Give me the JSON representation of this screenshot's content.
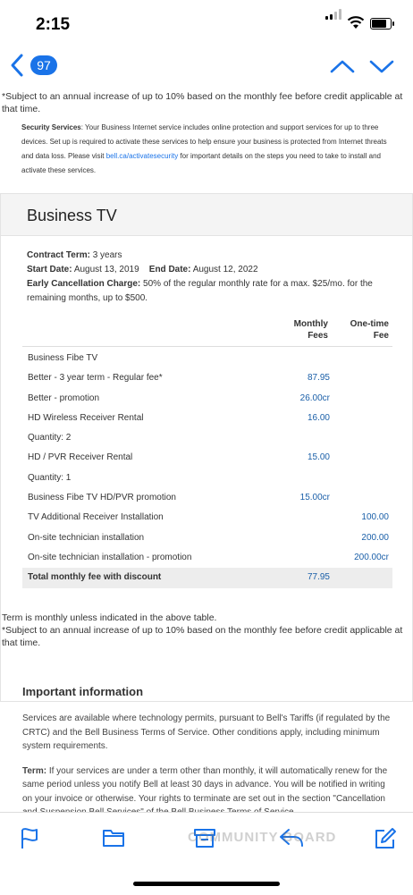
{
  "status": {
    "time": "2:15"
  },
  "nav": {
    "count": "97"
  },
  "top_note": "*Subject to an annual increase of up to 10% based on the monthly fee before credit applicable at that time.",
  "security": {
    "label": "Security Services",
    "text_before": ": Your Business Internet service includes online protection and support services for up to three devices. Set up is required to activate these services to help ensure your business is protected from Internet threats and data loss. Please visit ",
    "link": "bell.ca/activatesecurity",
    "text_after": " for important details on the steps you need to take to install and activate these services."
  },
  "card": {
    "title": "Business TV",
    "contract_term_label": "Contract Term:",
    "contract_term_value": "3 years",
    "start_label": "Start Date:",
    "start_value": "August 13, 2019",
    "end_label": "End Date:",
    "end_value": "August 12, 2022",
    "ecc_label": "Early Cancellation Charge:",
    "ecc_value": "50% of the regular monthly rate for a max. $25/mo. for the remaining months, up to $500.",
    "col_monthly": "Monthly Fees",
    "col_onetime": "One-time Fee",
    "rows": [
      {
        "label": "Business Fibe TV",
        "monthly": "",
        "onetime": ""
      },
      {
        "label": "Better - 3 year term - Regular fee*",
        "monthly": "87.95",
        "onetime": ""
      },
      {
        "label": "Better - promotion",
        "monthly": "26.00cr",
        "onetime": ""
      },
      {
        "label": "HD Wireless Receiver Rental",
        "monthly": "16.00",
        "onetime": ""
      },
      {
        "label": "Quantity: 2",
        "monthly": "",
        "onetime": ""
      },
      {
        "label": "HD / PVR Receiver Rental",
        "monthly": "15.00",
        "onetime": ""
      },
      {
        "label": "Quantity: 1",
        "monthly": "",
        "onetime": ""
      },
      {
        "label": "Business Fibe TV HD/PVR promotion",
        "monthly": "15.00cr",
        "onetime": ""
      },
      {
        "label": "TV Additional Receiver Installation",
        "monthly": "",
        "onetime": "100.00"
      },
      {
        "label": "On-site technician installation",
        "monthly": "",
        "onetime": "200.00"
      },
      {
        "label": "On-site technician installation - promotion",
        "monthly": "",
        "onetime": "200.00cr"
      }
    ],
    "total_label": "Total monthly fee with discount",
    "total_value": "77.95"
  },
  "after_notes": {
    "line1": "Term is monthly unless indicated in the above table.",
    "line2": "*Subject to an annual increase of up to 10% based on the monthly fee before credit applicable at that time."
  },
  "important": {
    "title": "Important information",
    "para1": "Services are available where technology permits, pursuant to Bell's Tariffs (if regulated by the CRTC) and the Bell Business Terms of Service. Other conditions apply, including minimum system requirements.",
    "term_label": "Term:",
    "term_text": " If your services are under a term other than monthly, it will automatically renew for the same period unless you notify Bell at least 30 days in advance. You will be notified in writing on your invoice or otherwise. Your rights to terminate are set out in the section \"Cancellation and Suspension Bell Services\" of the Bell Business Terms of Service."
  },
  "watermark": "COMMUNITY BOARD",
  "colors": {
    "accent": "#1a73e8"
  }
}
